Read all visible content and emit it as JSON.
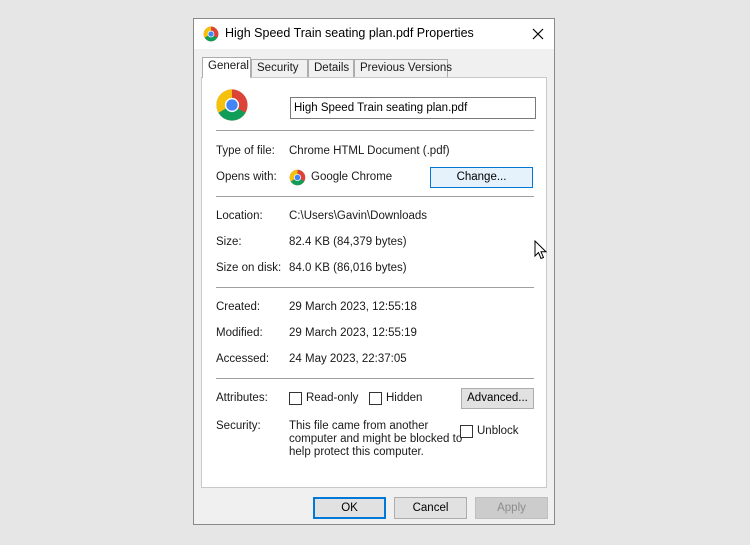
{
  "window": {
    "title": "High Speed Train seating plan.pdf Properties"
  },
  "tabs": [
    "General",
    "Security",
    "Details",
    "Previous Versions"
  ],
  "general": {
    "file_name": "High Speed Train seating plan.pdf",
    "type_label": "Type of file:",
    "type_value": "Chrome HTML Document (.pdf)",
    "opens_label": "Opens with:",
    "opens_value": "Google Chrome",
    "change_label": "Change...",
    "location_label": "Location:",
    "location_value": "C:\\Users\\Gavin\\Downloads",
    "size_label": "Size:",
    "size_value": "82.4 KB (84,379 bytes)",
    "size_on_disk_label": "Size on disk:",
    "size_on_disk_value": "84.0 KB (86,016 bytes)",
    "created_label": "Created:",
    "created_value": "29 March 2023, 12:55:18",
    "modified_label": "Modified:",
    "modified_value": "29 March 2023, 12:55:19",
    "accessed_label": "Accessed:",
    "accessed_value": "24 May 2023, 22:37:05",
    "attributes_label": "Attributes:",
    "readonly_label": "Read-only",
    "hidden_label": "Hidden",
    "advanced_label": "Advanced...",
    "security_label": "Security:",
    "security_line1": "This file came from another",
    "security_line2": "computer and might be blocked to",
    "security_line3": "help protect this computer.",
    "unblock_label": "Unblock"
  },
  "footer": {
    "ok": "OK",
    "cancel": "Cancel",
    "apply": "Apply"
  },
  "colors": {
    "accent": "#0078d7",
    "chrome_red": "#db4437",
    "chrome_yellow": "#f4c20d",
    "chrome_green": "#0f9d58",
    "chrome_blue": "#4285f4"
  },
  "icons": {
    "app": "chrome-icon",
    "close": "close-icon",
    "cursor": "mouse-pointer-icon"
  }
}
